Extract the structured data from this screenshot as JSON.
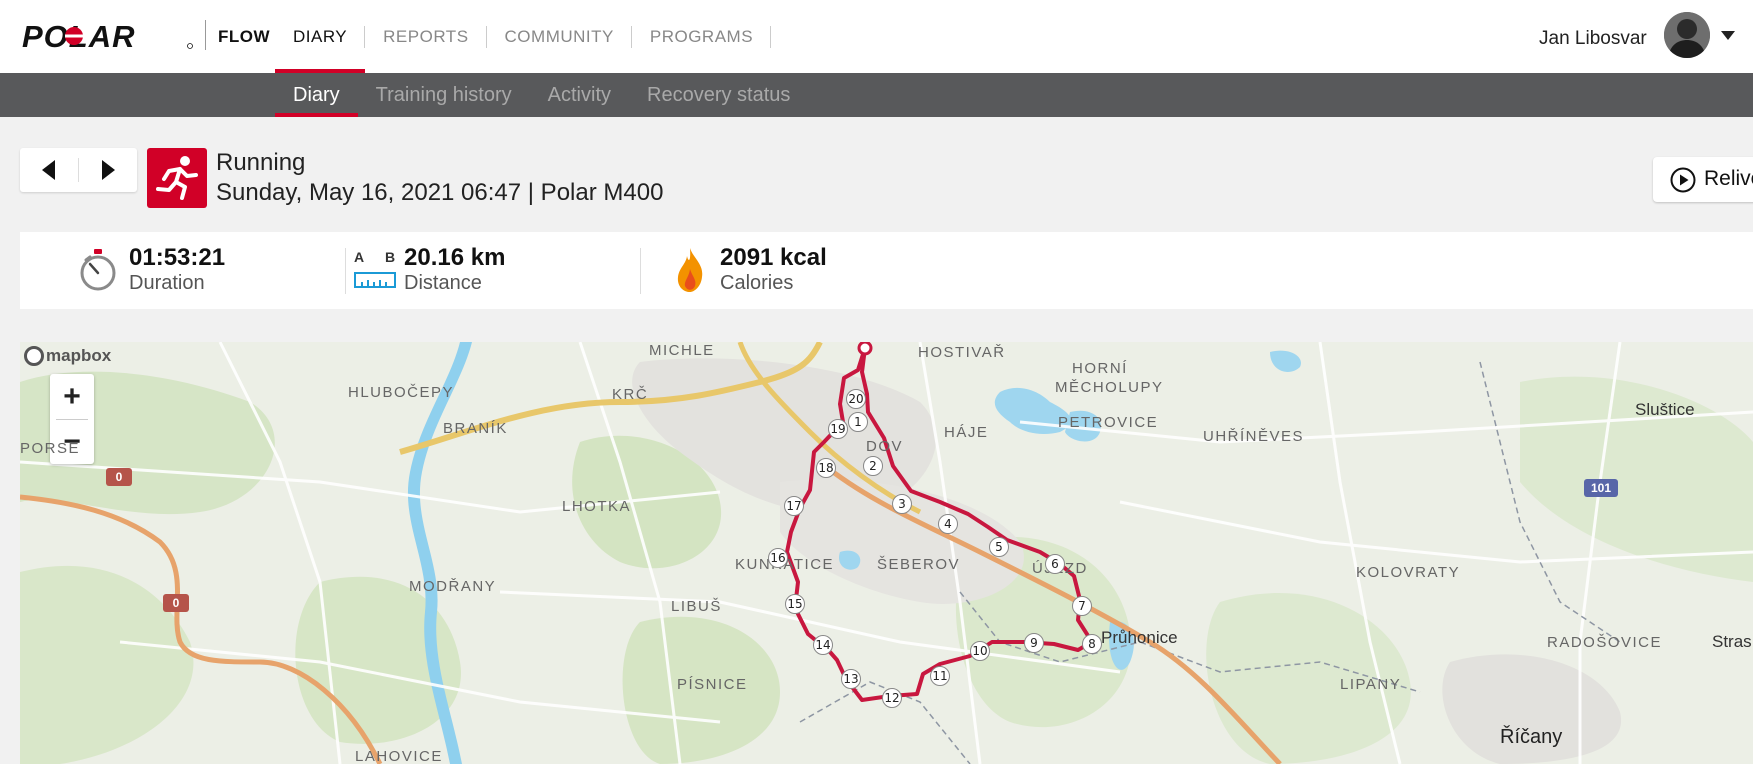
{
  "brand": {
    "logo_text": "POLAR",
    "product": "FLOW"
  },
  "nav": {
    "items": [
      {
        "label": "DIARY",
        "active": true
      },
      {
        "label": "REPORTS",
        "active": false
      },
      {
        "label": "COMMUNITY",
        "active": false
      },
      {
        "label": "PROGRAMS",
        "active": false
      }
    ]
  },
  "user": {
    "name": "Jan Libosvar"
  },
  "subnav": {
    "items": [
      {
        "label": "Diary",
        "active": true
      },
      {
        "label": "Training history",
        "active": false
      },
      {
        "label": "Activity",
        "active": false
      },
      {
        "label": "Recovery status",
        "active": false
      }
    ]
  },
  "session": {
    "sport": "Running",
    "datetime_device": "Sunday, May 16, 2021 06:47 | Polar M400",
    "relive_label": "Relive"
  },
  "stats": {
    "duration": {
      "value": "01:53:21",
      "label": "Duration"
    },
    "distance": {
      "value": "20.16 km",
      "label": "Distance",
      "icon_a": "A",
      "icon_b": "B"
    },
    "calories": {
      "value": "2091 kcal",
      "label": "Calories"
    }
  },
  "map": {
    "attribution": "mapbox",
    "zoom_in": "+",
    "zoom_out": "−",
    "route_color": "#c8173f",
    "places": [
      {
        "name": "MICHLE"
      },
      {
        "name": "HOSTIVAŘ"
      },
      {
        "name": "HLUBOČEPY"
      },
      {
        "name": "KRČ"
      },
      {
        "name": "HORNÍ"
      },
      {
        "name": "MĚCHOLUPY"
      },
      {
        "name": "BRANÍK"
      },
      {
        "name": "PETROVICE"
      },
      {
        "name": "HÁJE"
      },
      {
        "name": "UHŘÍNĚVES"
      },
      {
        "name": "DOV"
      },
      {
        "name": "PORSE"
      },
      {
        "name": "LHOTKA"
      },
      {
        "name": "KUNRATICE"
      },
      {
        "name": "ŠEBEROV"
      },
      {
        "name": "ÚJEZD"
      },
      {
        "name": "KOLOVRATY"
      },
      {
        "name": "MODŘANY"
      },
      {
        "name": "LIBUŠ"
      },
      {
        "name": "Průhonice"
      },
      {
        "name": "LIPANY"
      },
      {
        "name": "RADOŠOVICE"
      },
      {
        "name": "PÍSNICE"
      },
      {
        "name": "Říčany"
      },
      {
        "name": "LAHOVICE"
      },
      {
        "name": "Sluštice"
      },
      {
        "name": "Stras"
      }
    ],
    "road_badges": [
      "0",
      "0",
      "101"
    ],
    "km_markers": [
      "1",
      "2",
      "3",
      "4",
      "5",
      "6",
      "7",
      "8",
      "9",
      "10",
      "11",
      "12",
      "13",
      "14",
      "15",
      "16",
      "17",
      "18",
      "19",
      "20"
    ]
  }
}
